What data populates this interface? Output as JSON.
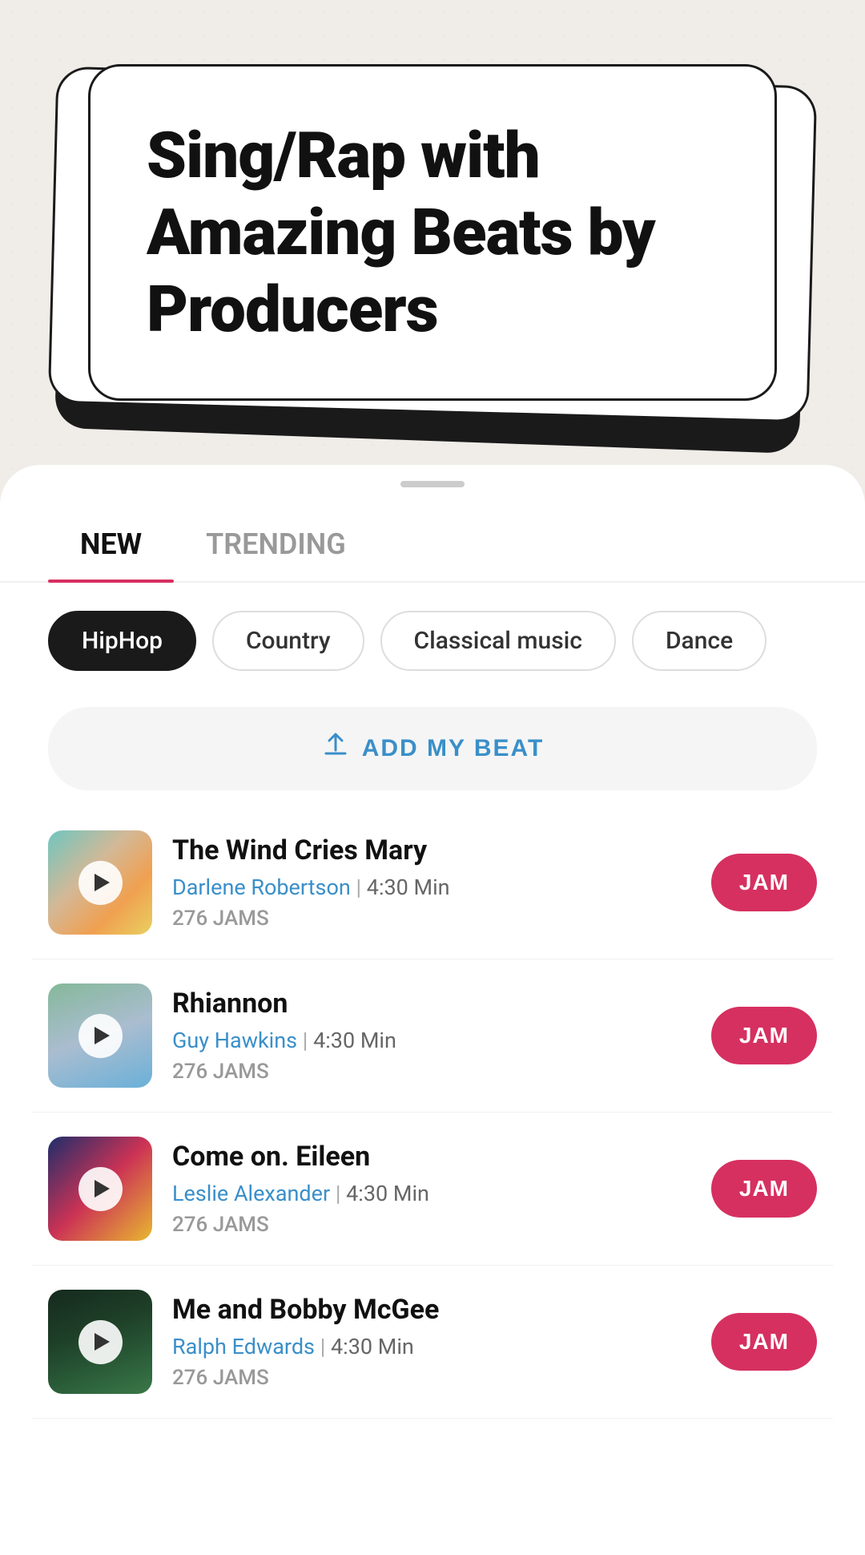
{
  "hero": {
    "title": "Sing/Rap with Amazing Beats by Producers"
  },
  "tabs": [
    {
      "id": "new",
      "label": "NEW",
      "active": true
    },
    {
      "id": "trending",
      "label": "TRENDING",
      "active": false
    }
  ],
  "genres": [
    {
      "id": "hiphop",
      "label": "HipHop",
      "active": true
    },
    {
      "id": "country",
      "label": "Country",
      "active": false
    },
    {
      "id": "classical",
      "label": "Classical music",
      "active": false
    },
    {
      "id": "dance",
      "label": "Dance",
      "active": false
    }
  ],
  "add_beat": {
    "label": "ADD MY BEAT"
  },
  "tracks": [
    {
      "id": 1,
      "title": "The Wind Cries Mary",
      "artist": "Darlene Robertson",
      "duration": "4:30 Min",
      "jams": "276 JAMS",
      "thumb_class": "thumb-1-img"
    },
    {
      "id": 2,
      "title": "Rhiannon",
      "artist": "Guy Hawkins",
      "duration": "4:30 Min",
      "jams": "276 JAMS",
      "thumb_class": "thumb-2-img"
    },
    {
      "id": 3,
      "title": "Come on. Eileen",
      "artist": "Leslie Alexander",
      "duration": "4:30 Min",
      "jams": "276 JAMS",
      "thumb_class": "thumb-3-img"
    },
    {
      "id": 4,
      "title": "Me and Bobby McGee",
      "artist": "Ralph Edwards",
      "duration": "4:30 Min",
      "jams": "276 JAMS",
      "thumb_class": "thumb-4-img"
    }
  ],
  "jam_button_label": "JAM",
  "colors": {
    "accent": "#d63060",
    "link": "#3a8fc9"
  }
}
